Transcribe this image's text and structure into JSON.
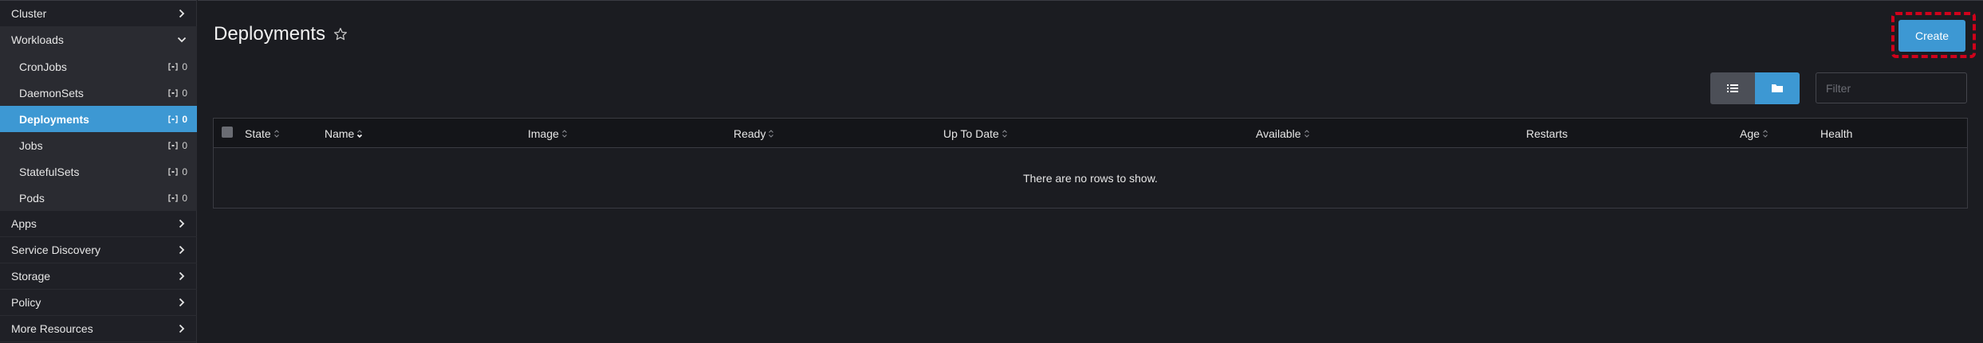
{
  "sidebar": {
    "groups_top": [
      {
        "label": "Cluster",
        "state": "collapsed"
      },
      {
        "label": "Workloads",
        "state": "expanded"
      }
    ],
    "workloads": [
      {
        "label": "CronJobs",
        "count": "0"
      },
      {
        "label": "DaemonSets",
        "count": "0"
      },
      {
        "label": "Deployments",
        "count": "0",
        "active": true
      },
      {
        "label": "Jobs",
        "count": "0"
      },
      {
        "label": "StatefulSets",
        "count": "0"
      },
      {
        "label": "Pods",
        "count": "0"
      }
    ],
    "groups_bottom": [
      {
        "label": "Apps"
      },
      {
        "label": "Service Discovery"
      },
      {
        "label": "Storage"
      },
      {
        "label": "Policy"
      },
      {
        "label": "More Resources"
      }
    ]
  },
  "header": {
    "title": "Deployments",
    "create_label": "Create"
  },
  "toolbar": {
    "filter_placeholder": "Filter",
    "view_modes": [
      "list-icon",
      "folder-icon"
    ],
    "active_view": "folder-icon"
  },
  "table": {
    "columns": [
      "State",
      "Name",
      "Image",
      "Ready",
      "Up To Date",
      "Available",
      "Restarts",
      "Age",
      "Health"
    ],
    "empty_message": "There are no rows to show."
  },
  "colors": {
    "accent": "#3d98d3",
    "background": "#1b1c21",
    "sidebar": "#1f2026",
    "highlight": "#d0021b"
  }
}
